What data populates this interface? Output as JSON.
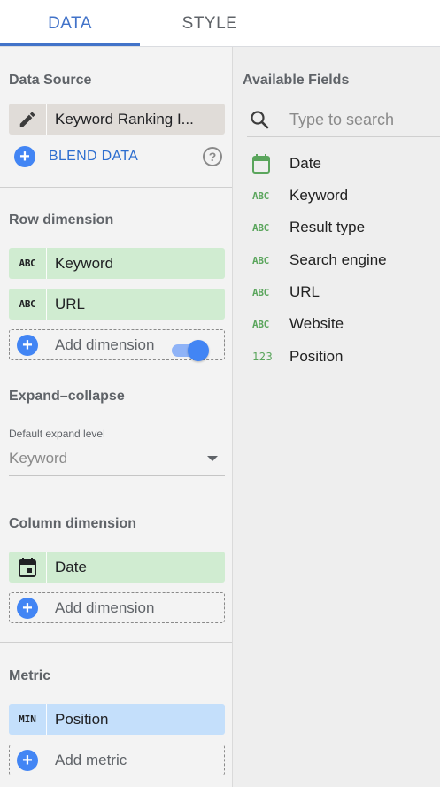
{
  "tabs": [
    {
      "label": "DATA",
      "active": true
    },
    {
      "label": "STYLE",
      "active": false
    }
  ],
  "data_source": {
    "title": "Data Source",
    "name": "Keyword Ranking I...",
    "blend_label": "BLEND DATA",
    "help_icon": "?"
  },
  "row_dimension": {
    "title": "Row dimension",
    "items": [
      {
        "type": "ABC",
        "label": "Keyword"
      },
      {
        "type": "ABC",
        "label": "URL"
      }
    ],
    "add_label": "Add dimension"
  },
  "expand_collapse": {
    "title": "Expand–collapse",
    "enabled": true,
    "default_level_label": "Default expand level",
    "default_level_value": "Keyword"
  },
  "column_dimension": {
    "title": "Column dimension",
    "items": [
      {
        "type": "date",
        "label": "Date"
      }
    ],
    "add_label": "Add dimension"
  },
  "metric": {
    "title": "Metric",
    "items": [
      {
        "type": "MIN",
        "label": "Position"
      }
    ],
    "add_label": "Add metric"
  },
  "available_fields": {
    "title": "Available Fields",
    "search_placeholder": "Type to search",
    "fields": [
      {
        "type": "date",
        "label": "Date"
      },
      {
        "type": "ABC",
        "label": "Keyword"
      },
      {
        "type": "ABC",
        "label": "Result type"
      },
      {
        "type": "ABC",
        "label": "Search engine"
      },
      {
        "type": "ABC",
        "label": "URL"
      },
      {
        "type": "ABC",
        "label": "Website"
      },
      {
        "type": "123",
        "label": "Position"
      }
    ]
  },
  "colors": {
    "accent": "#4273c9",
    "dimension_chip": "#d0ecd1",
    "metric_chip": "#c4dffb",
    "field_type_icon": "#5aa55c"
  }
}
